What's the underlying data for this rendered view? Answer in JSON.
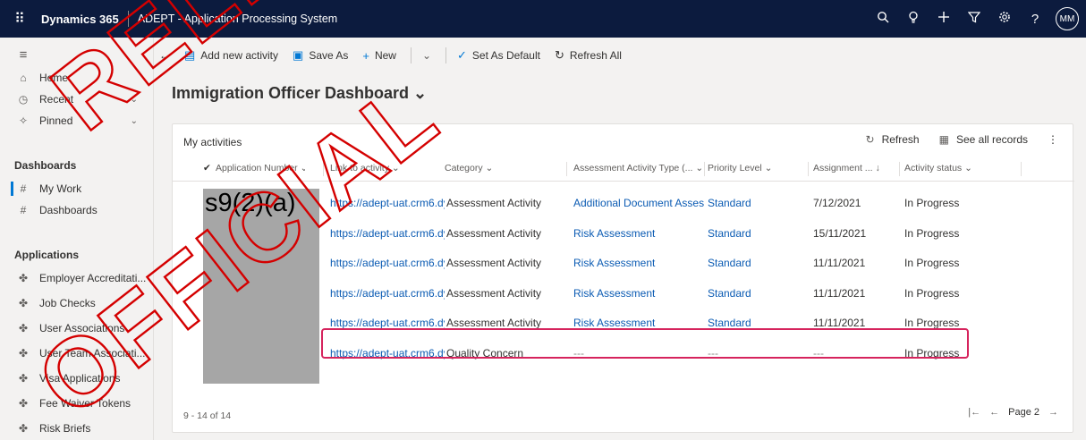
{
  "topbar": {
    "waffle_glyph": "⠿",
    "app_name": "Dynamics 365",
    "app_subtitle": "ADEPT - Application Processing System",
    "icons": [
      "search-icon",
      "lightbulb-icon",
      "plus-icon",
      "filter-icon",
      "gear-icon",
      "help-icon"
    ],
    "avatar_initials": "MM"
  },
  "sidebar": {
    "menu_glyph": "≡",
    "home": "Home",
    "recent": "Recent",
    "pinned": "Pinned",
    "dashboards_heading": "Dashboards",
    "my_work": "My Work",
    "dashboards": "Dashboards",
    "applications_heading": "Applications",
    "applications": [
      "Employer Accreditati...",
      "Job Checks",
      "User Associations",
      "User Team Associati...",
      "Visa Applications",
      "Fee Waiver Tokens",
      "Risk Briefs"
    ]
  },
  "commandbar": {
    "back_glyph": "←",
    "add_new_activity": "Add new activity",
    "save_as": "Save As",
    "new": "New",
    "set_as_default": "Set As Default",
    "refresh_all": "Refresh All"
  },
  "dashboard_title": "Immigration Officer Dashboard ⌄",
  "panel": {
    "title": "My activities",
    "refresh": "Refresh",
    "see_all": "See all records",
    "more": "⋮",
    "columns": [
      "Application Number ⌄",
      "Link to activity ⌄",
      "Category ⌄",
      "Assessment Activity Type (... ⌄",
      "Priority Level ⌄",
      "Assignment ... ↓",
      "Activity status ⌄"
    ],
    "rows": [
      {
        "link": "https://adept-uat.crm6.dy",
        "category": "Assessment Activity",
        "type": "Additional Document Asses",
        "priority": "Standard",
        "assignment": "7/12/2021",
        "status": "In Progress"
      },
      {
        "link": "https://adept-uat.crm6.dy",
        "category": "Assessment Activity",
        "type": "Risk Assessment",
        "priority": "Standard",
        "assignment": "15/11/2021",
        "status": "In Progress"
      },
      {
        "link": "https://adept-uat.crm6.dy",
        "category": "Assessment Activity",
        "type": "Risk Assessment",
        "priority": "Standard",
        "assignment": "11/11/2021",
        "status": "In Progress"
      },
      {
        "link": "https://adept-uat.crm6.dy",
        "category": "Assessment Activity",
        "type": "Risk Assessment",
        "priority": "Standard",
        "assignment": "11/11/2021",
        "status": "In Progress"
      },
      {
        "link": "https://adept-uat.crm6.dy",
        "category": "Assessment Activity",
        "type": "Risk Assessment",
        "priority": "Standard",
        "assignment": "11/11/2021",
        "status": "In Progress"
      },
      {
        "link": "https://adept-uat.crm6.dy",
        "category": "Quality Concern",
        "type": "---",
        "priority": "---",
        "assignment": "---",
        "status": "In Progress"
      }
    ],
    "redaction_label": "s9(2)(a)",
    "footer_count": "9 - 14 of 14",
    "page_label": "Page 2"
  },
  "watermark": {
    "line1": "RELEASED",
    "line2": "OFFICIAL",
    "color": "#d40000"
  },
  "colors": {
    "topbar": "#0c1b3e",
    "link": "#0b5bb3",
    "highlight": "#d6245d"
  }
}
